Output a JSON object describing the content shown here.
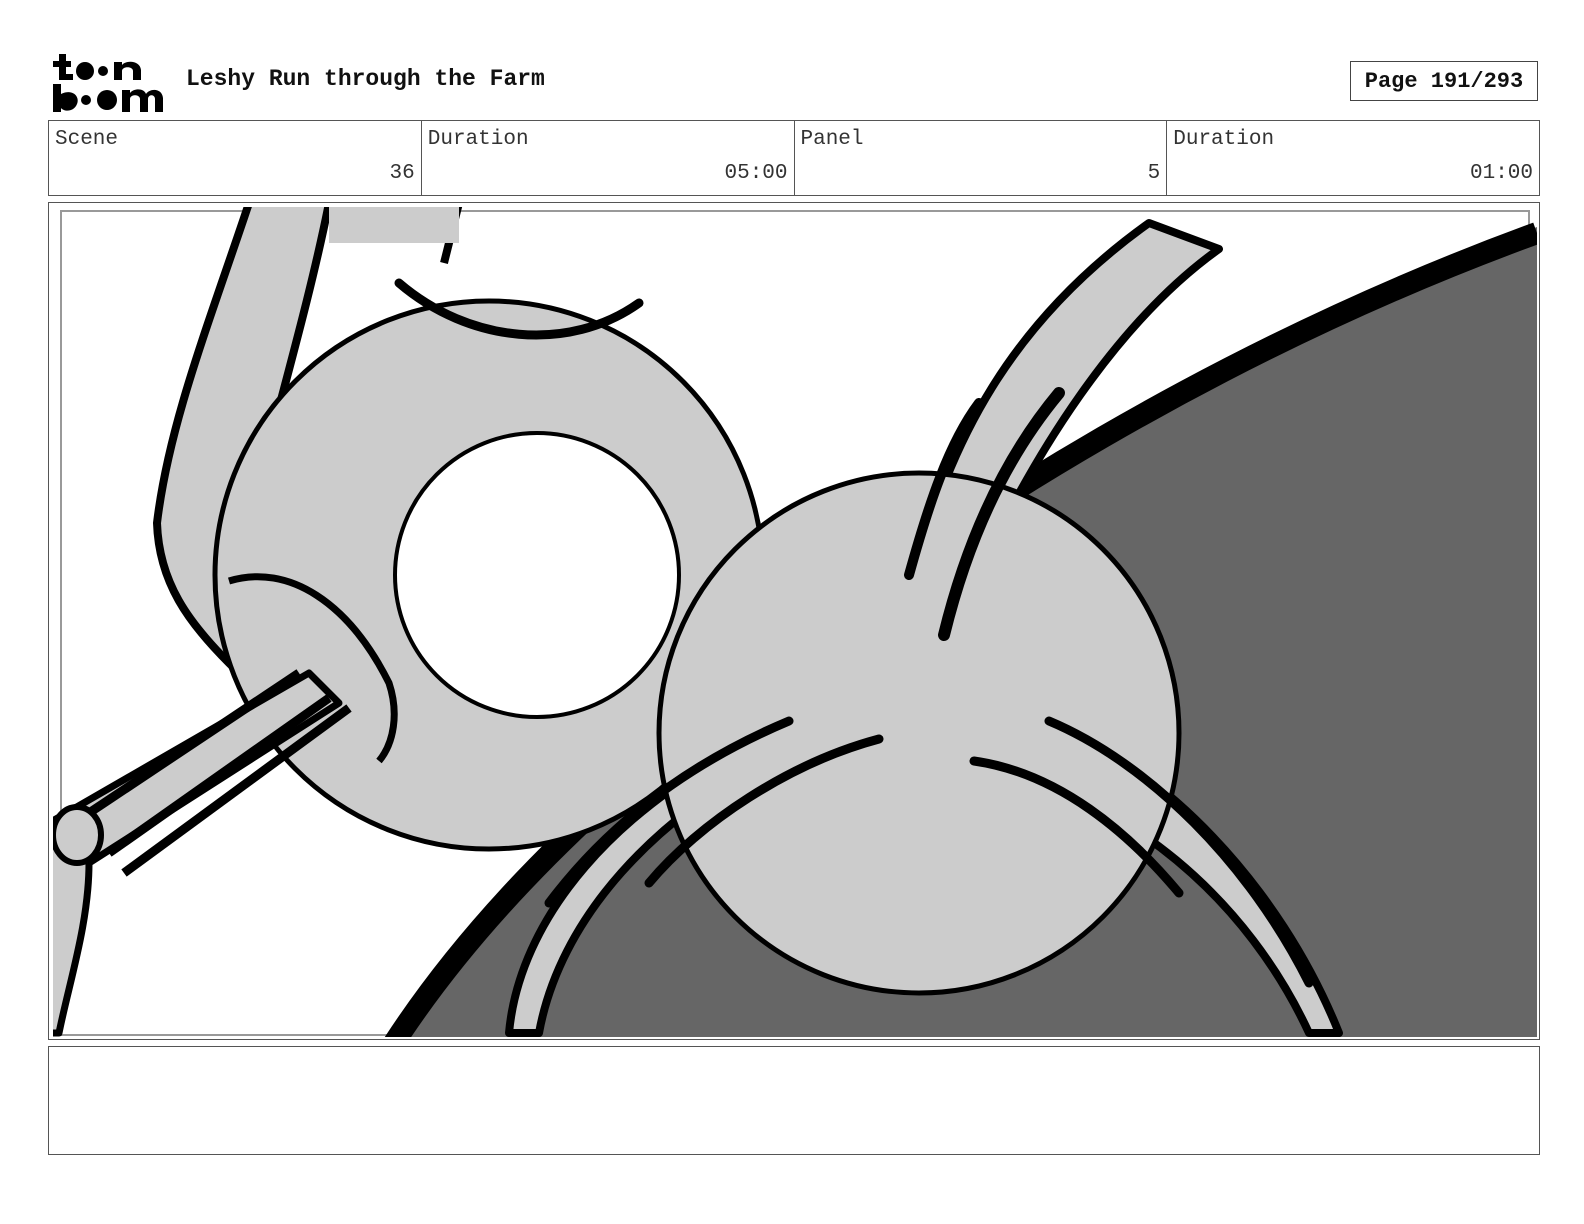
{
  "header": {
    "logo_text": "toon boom",
    "title": "Leshy Run through the Farm",
    "page_indicator": "Page 191/293"
  },
  "info": {
    "scene_label": "Scene",
    "scene_value": "36",
    "scene_duration_label": "Duration",
    "scene_duration_value": "05:00",
    "panel_label": "Panel",
    "panel_value": "5",
    "panel_duration_label": "Duration",
    "panel_duration_value": "01:00"
  },
  "colors": {
    "light_gray": "#cccccc",
    "dark_gray": "#666666",
    "ink": "#000000"
  },
  "notes": {
    "text": ""
  }
}
